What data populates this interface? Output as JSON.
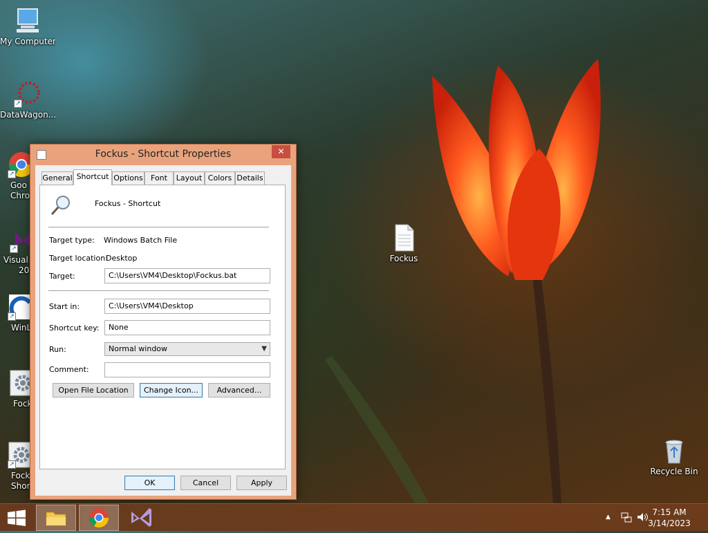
{
  "desktop": {
    "icons": [
      {
        "label": "My Computer"
      },
      {
        "label": "DataWagon..."
      },
      {
        "label": "Goo"
      },
      {
        "label": "Chro"
      },
      {
        "label": "Visual S"
      },
      {
        "label": "201"
      },
      {
        "label": "WinL"
      },
      {
        "label": "Fock"
      },
      {
        "label": "Fock"
      },
      {
        "label": "Short"
      },
      {
        "label": "Fockus"
      },
      {
        "label": "Recycle Bin"
      }
    ]
  },
  "dialog": {
    "title": "Fockus - Shortcut Properties",
    "close_glyph": "✕",
    "tabs": [
      {
        "label": "General"
      },
      {
        "label": "Shortcut"
      },
      {
        "label": "Options"
      },
      {
        "label": "Font"
      },
      {
        "label": "Layout"
      },
      {
        "label": "Colors"
      },
      {
        "label": "Details"
      }
    ],
    "active_tab": "Shortcut",
    "header_name": "Fockus - Shortcut",
    "target_type_label": "Target type:",
    "target_type_value": "Windows Batch File",
    "target_location_label": "Target location:",
    "target_location_value": "Desktop",
    "target_label": "Target:",
    "target_value": "C:\\Users\\VM4\\Desktop\\Fockus.bat",
    "start_in_label": "Start in:",
    "start_in_value": "C:\\Users\\VM4\\Desktop",
    "shortcut_key_label": "Shortcut key:",
    "shortcut_key_value": "None",
    "run_label": "Run:",
    "run_value": "Normal window",
    "comment_label": "Comment:",
    "comment_value": "",
    "open_file_location_label": "Open File Location",
    "change_icon_label": "Change Icon...",
    "advanced_label": "Advanced...",
    "ok_label": "OK",
    "cancel_label": "Cancel",
    "apply_label": "Apply"
  },
  "taskbar": {
    "time": "7:15 AM",
    "date": "3/14/2023",
    "tray_chevron": "▲"
  },
  "colors": {
    "taskbar": "#6e3c1e",
    "dialog_frame": "#e9a37c",
    "close_button": "#c74f40"
  }
}
